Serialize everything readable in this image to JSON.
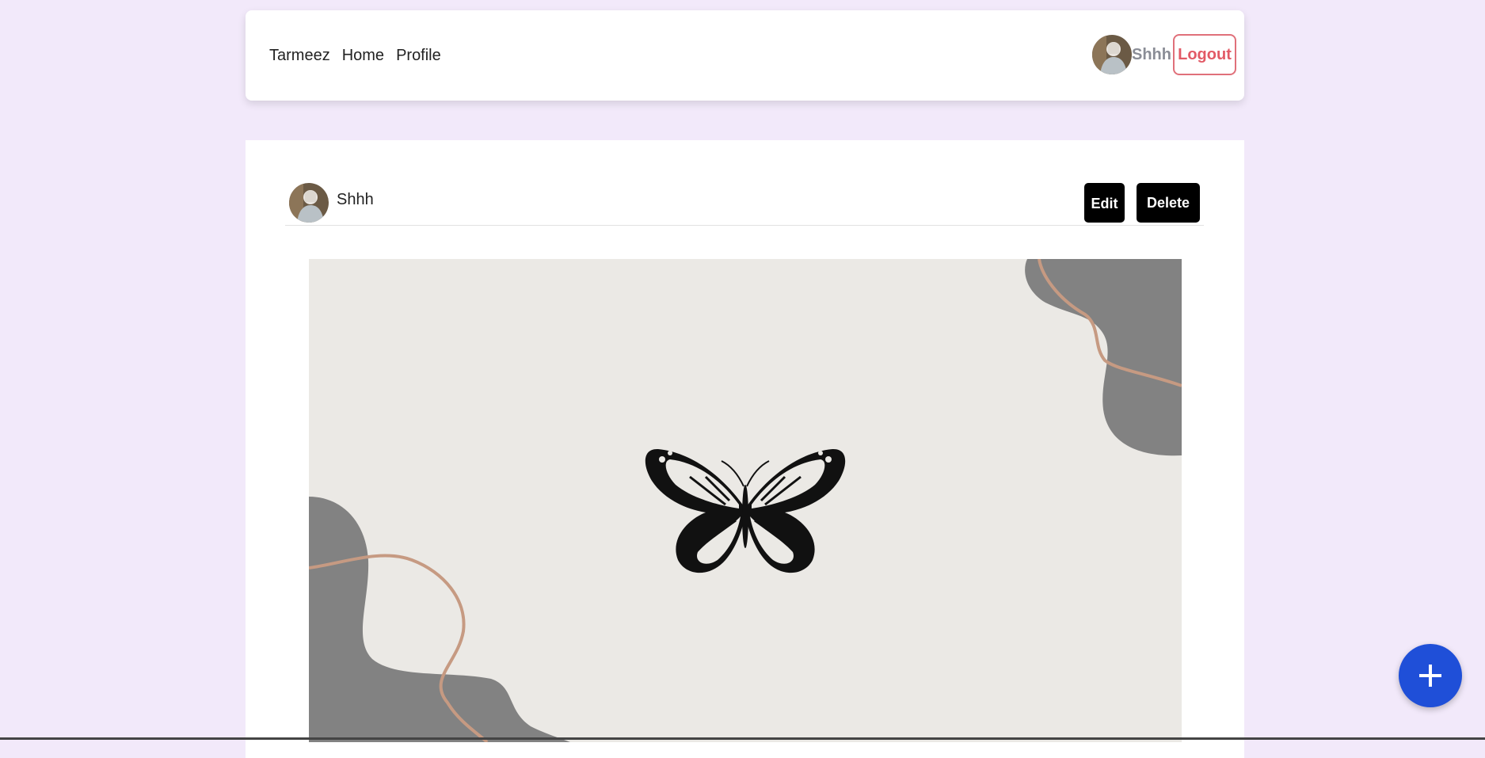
{
  "navbar": {
    "links": [
      "Tarmeez",
      "Home",
      "Profile"
    ],
    "username": "Shhh",
    "logout_label": "Logout",
    "avatar_icon": "user-avatar"
  },
  "post": {
    "author": "Shhh",
    "edit_label": "Edit",
    "delete_label": "Delete",
    "image_icon": "butterfly-illustration"
  },
  "fab": {
    "icon": "plus-icon"
  },
  "colors": {
    "page_background": "#f2e9fa",
    "logout_accent": "#e25a66",
    "fab_blue": "#1f4fd8",
    "button_dark": "#000000"
  }
}
